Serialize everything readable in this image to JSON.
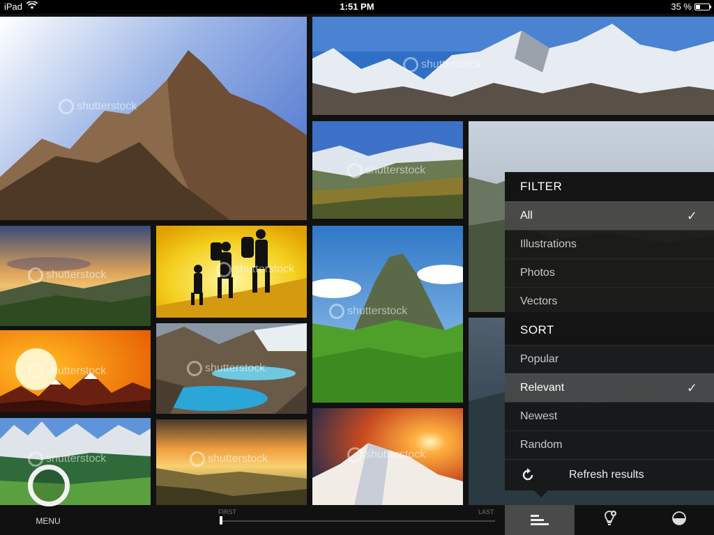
{
  "status_bar": {
    "device": "iPad",
    "time": "1:51 PM",
    "battery": "35 %",
    "battery_level": 0.35
  },
  "watermark": "shutterstock",
  "filter_panel": {
    "filter_header": "FILTER",
    "filter_options": [
      {
        "label": "All",
        "selected": true
      },
      {
        "label": "Illustrations",
        "selected": false
      },
      {
        "label": "Photos",
        "selected": false
      },
      {
        "label": "Vectors",
        "selected": false
      }
    ],
    "sort_header": "SORT",
    "sort_options": [
      {
        "label": "Popular",
        "selected": false
      },
      {
        "label": "Relevant",
        "selected": true
      },
      {
        "label": "Newest",
        "selected": false
      },
      {
        "label": "Random",
        "selected": false
      }
    ],
    "check_glyph": "✓",
    "refresh_icon": "refresh-icon",
    "refresh_label": "Refresh results"
  },
  "bottom_bar": {
    "menu_label": "MENU",
    "scrubber_first": "FIRST",
    "scrubber_last": "LAST",
    "scrubber_position": 0.0,
    "tabs": [
      {
        "icon": "sort-lines-icon",
        "active": true
      },
      {
        "icon": "lightbulb-add-icon",
        "active": false
      },
      {
        "icon": "half-circle-icon",
        "active": false
      }
    ]
  },
  "colors": {
    "panel_bg": "#141414",
    "selected_row": "#6e6e6e",
    "active_tab": "#4a4a4a"
  }
}
